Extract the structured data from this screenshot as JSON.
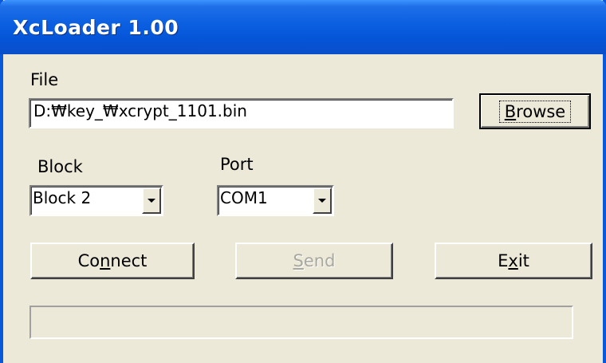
{
  "window": {
    "title": "XcLoader 1.00"
  },
  "file": {
    "label": "File",
    "path_value": "D:₩key_₩xcrypt_1101.bin",
    "browse_prefix": "",
    "browse_mnemonic": "B",
    "browse_suffix": "rowse"
  },
  "block": {
    "label": "Block",
    "selected": "Block 2"
  },
  "port": {
    "label": "Port",
    "selected": "COM1"
  },
  "actions": {
    "connect_prefix": "Co",
    "connect_mnemonic": "n",
    "connect_suffix": "nect",
    "send_prefix": "",
    "send_mnemonic": "S",
    "send_suffix": "end",
    "exit_prefix": "E",
    "exit_mnemonic": "x",
    "exit_suffix": "it"
  },
  "progress": {
    "value_percent": 0
  },
  "colors": {
    "titlebar": "#0553d6",
    "window_face": "#ece9d8",
    "disabled_text": "#a9a89f"
  },
  "icons": {
    "combo_arrow": "chevron-down-icon"
  }
}
